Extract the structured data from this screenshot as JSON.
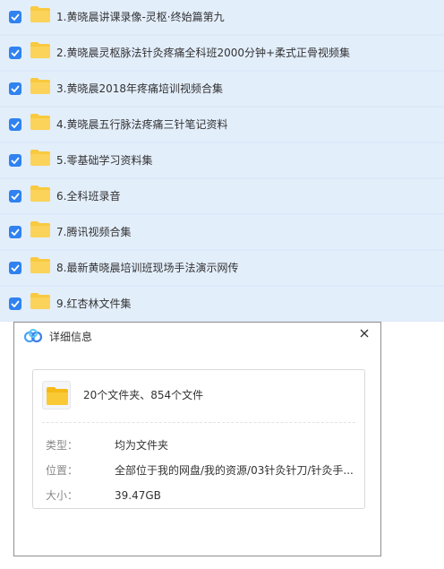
{
  "files": [
    {
      "name": "1.黄晓晨讲课录像-灵枢·终始篇第九",
      "checked": true
    },
    {
      "name": "2.黄晓晨灵枢脉法针灸疼痛全科班2000分钟+柔式正骨视频集",
      "checked": true
    },
    {
      "name": "3.黄晓晨2018年疼痛培训视频合集",
      "checked": true
    },
    {
      "name": "4.黄晓晨五行脉法疼痛三针笔记资料",
      "checked": true
    },
    {
      "name": "5.零基础学习资料集",
      "checked": true
    },
    {
      "name": "6.全科班录音",
      "checked": true
    },
    {
      "name": "7.腾讯视频合集",
      "checked": true
    },
    {
      "name": "8.最新黄晓晨培训班现场手法演示网传",
      "checked": true
    },
    {
      "name": "9.红杏林文件集",
      "checked": true
    }
  ],
  "detail": {
    "title": "详细信息",
    "summary": "20个文件夹、854个文件",
    "type_label": "类型：",
    "type_value": "均为文件夹",
    "location_label": "位置：",
    "location_value": "全部位于我的网盘/我的资源/03针灸针刀/针灸手...",
    "size_label": "大小：",
    "size_value": "39.47GB"
  },
  "colors": {
    "checkbox": "#2f82f0",
    "folder": "#f9c93f",
    "row_bg": "#e3eefb"
  }
}
